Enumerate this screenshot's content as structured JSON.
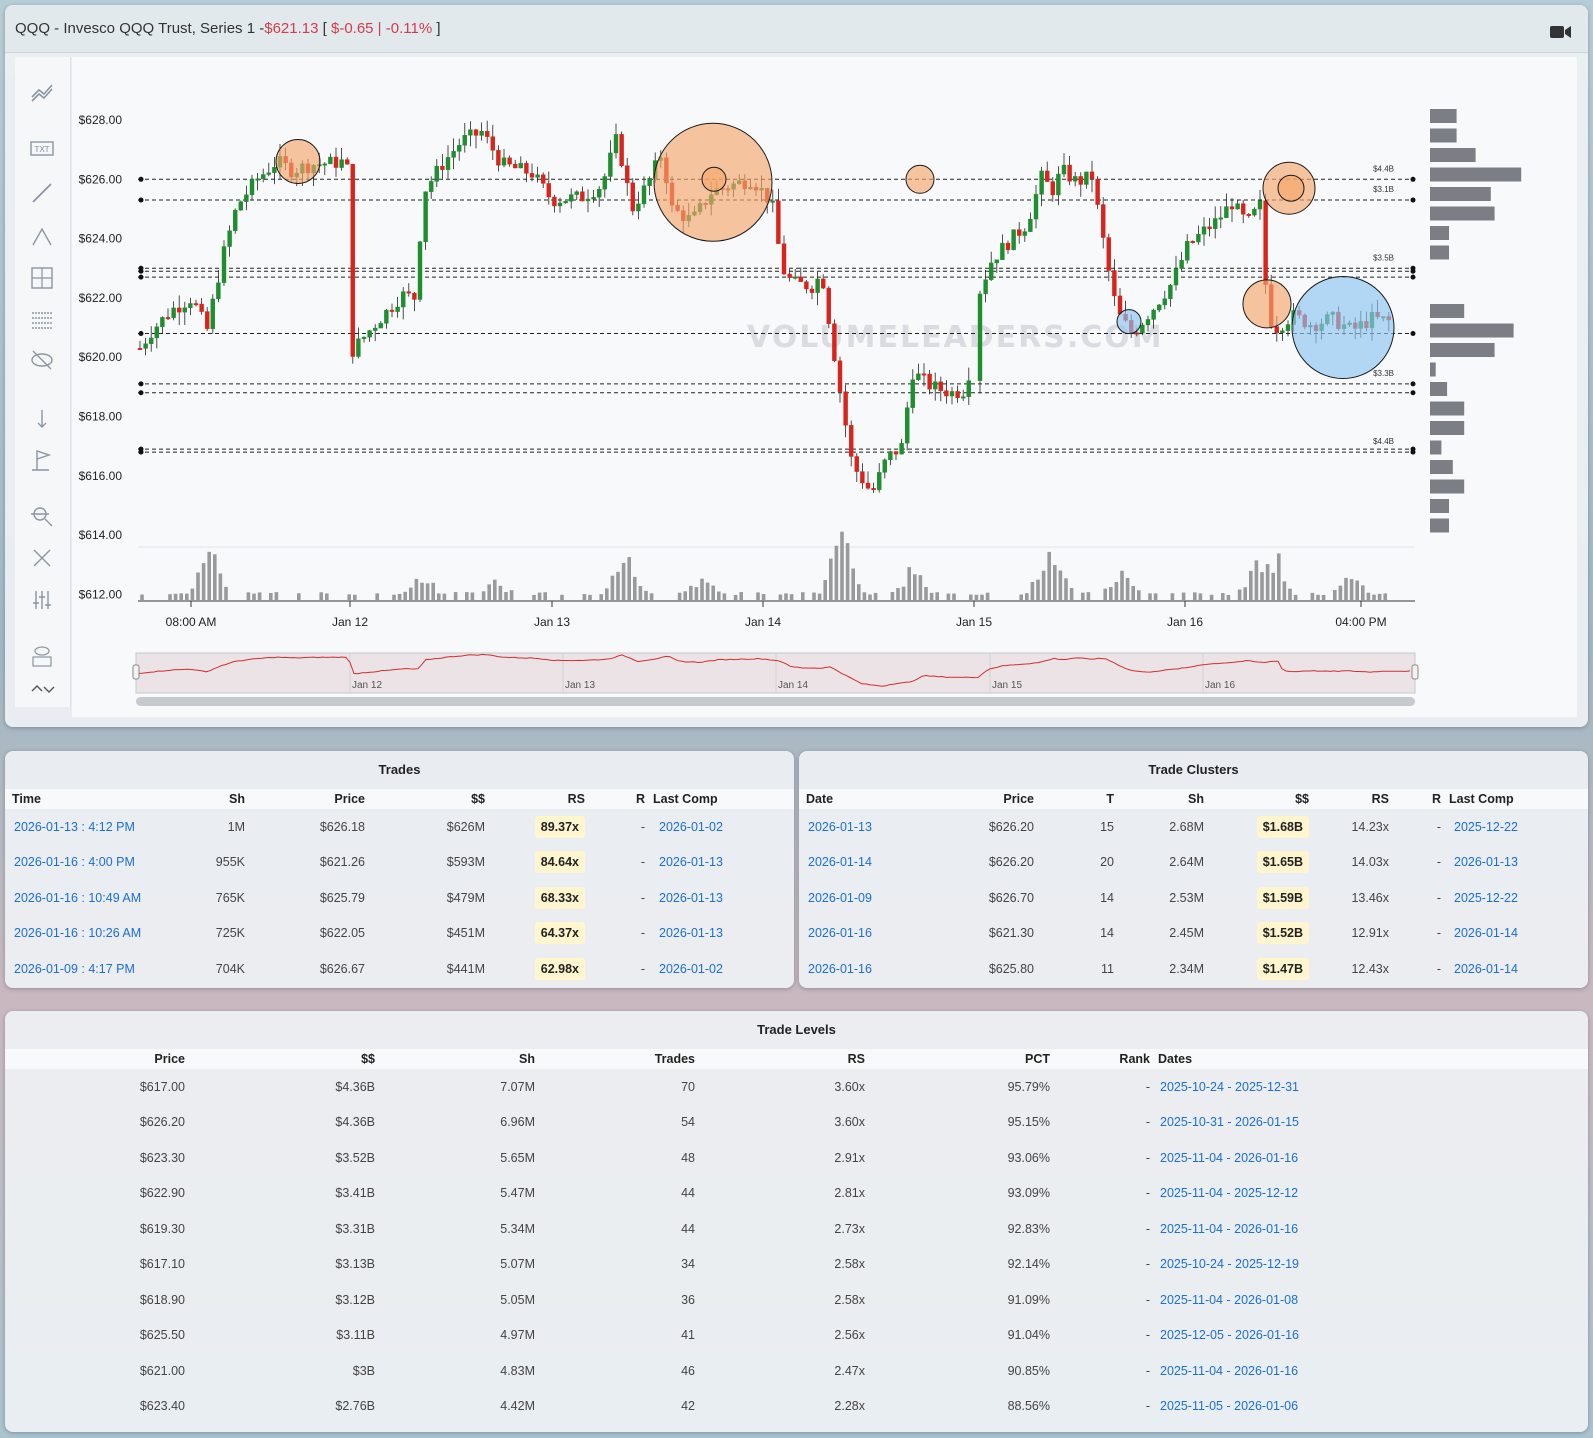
{
  "header": {
    "title": "QQQ - Invesco QQQ Trust, Series 1 - ",
    "price": "$621.13",
    "open_bracket": " [ ",
    "change": "$-0.65 | -0.11%",
    "close_bracket": " ]"
  },
  "chart": {
    "watermark": "VOLUMELEADERS.COM",
    "y_ticks": [
      "$628.00",
      "$626.00",
      "$624.00",
      "$622.00",
      "$620.00",
      "$618.00",
      "$616.00",
      "$614.00",
      "$612.00"
    ],
    "x_ticks": [
      "08:00 AM",
      "Jan 12",
      "Jan 13",
      "Jan 14",
      "Jan 15",
      "Jan 16",
      "04:00 PM"
    ],
    "navigator_ticks": [
      "Jan 12",
      "Jan 13",
      "Jan 14",
      "Jan 15",
      "Jan 16"
    ],
    "level_labels": [
      "$4.4B",
      "$3.1B",
      "$3.5B",
      "$3.3B",
      "$4.4B"
    ],
    "tools": [
      "trend-icon",
      "text-icon",
      "line-icon",
      "fib-icon",
      "crosshair-icon",
      "grid-icon",
      "hide-icon",
      "measure-icon",
      "flag-icon",
      "zoom-icon",
      "fullscreen-icon",
      "adjust-icon",
      "eye-value-icon",
      "folder-icon"
    ],
    "colors": {
      "up": "#1e8e2e",
      "down": "#d9241c",
      "orange_bubble": "#f5a66a",
      "blue_bubble": "#8cc4f0",
      "volume": "#9a9a9a",
      "profile": "#7b7f85"
    }
  },
  "trades": {
    "title": "Trades",
    "headers": [
      "Time",
      "Sh",
      "Price",
      "$$",
      "RS",
      "R",
      "Last Comp"
    ],
    "rows": [
      [
        "2026-01-13 : 4:12 PM",
        "1M",
        "$626.18",
        "$626M",
        "89.37x",
        "-",
        "2026-01-02"
      ],
      [
        "2026-01-16 : 4:00 PM",
        "955K",
        "$621.26",
        "$593M",
        "84.64x",
        "-",
        "2026-01-13"
      ],
      [
        "2026-01-16 : 10:49 AM",
        "765K",
        "$625.79",
        "$479M",
        "68.33x",
        "-",
        "2026-01-13"
      ],
      [
        "2026-01-16 : 10:26 AM",
        "725K",
        "$622.05",
        "$451M",
        "64.37x",
        "-",
        "2026-01-13"
      ],
      [
        "2026-01-09 : 4:17 PM",
        "704K",
        "$626.67",
        "$441M",
        "62.98x",
        "-",
        "2026-01-02"
      ]
    ]
  },
  "clusters": {
    "title": "Trade Clusters",
    "headers": [
      "Date",
      "Price",
      "T",
      "Sh",
      "$$",
      "RS",
      "R",
      "Last Comp"
    ],
    "rows": [
      [
        "2026-01-13",
        "$626.20",
        "15",
        "2.68M",
        "$1.68B",
        "14.23x",
        "-",
        "2025-12-22"
      ],
      [
        "2026-01-14",
        "$626.20",
        "20",
        "2.64M",
        "$1.65B",
        "14.03x",
        "-",
        "2026-01-13"
      ],
      [
        "2026-01-09",
        "$626.70",
        "14",
        "2.53M",
        "$1.59B",
        "13.46x",
        "-",
        "2025-12-22"
      ],
      [
        "2026-01-16",
        "$621.30",
        "14",
        "2.45M",
        "$1.52B",
        "12.91x",
        "-",
        "2026-01-14"
      ],
      [
        "2026-01-16",
        "$625.80",
        "11",
        "2.34M",
        "$1.47B",
        "12.43x",
        "-",
        "2026-01-14"
      ]
    ]
  },
  "levels": {
    "title": "Trade Levels",
    "headers": [
      "Price",
      "$$",
      "Sh",
      "Trades",
      "RS",
      "PCT",
      "Rank",
      "Dates"
    ],
    "rows": [
      [
        "$617.00",
        "$4.36B",
        "7.07M",
        "70",
        "3.60x",
        "95.79%",
        "-",
        "2025-10-24 - 2025-12-31"
      ],
      [
        "$626.20",
        "$4.36B",
        "6.96M",
        "54",
        "3.60x",
        "95.15%",
        "-",
        "2025-10-31 - 2026-01-15"
      ],
      [
        "$623.30",
        "$3.52B",
        "5.65M",
        "48",
        "2.91x",
        "93.06%",
        "-",
        "2025-11-04 - 2026-01-16"
      ],
      [
        "$622.90",
        "$3.41B",
        "5.47M",
        "44",
        "2.81x",
        "93.09%",
        "-",
        "2025-11-04 - 2025-12-12"
      ],
      [
        "$619.30",
        "$3.31B",
        "5.34M",
        "44",
        "2.73x",
        "92.83%",
        "-",
        "2025-11-04 - 2026-01-16"
      ],
      [
        "$617.10",
        "$3.13B",
        "5.07M",
        "34",
        "2.58x",
        "92.14%",
        "-",
        "2025-10-24 - 2025-12-19"
      ],
      [
        "$618.90",
        "$3.12B",
        "5.05M",
        "36",
        "2.58x",
        "91.09%",
        "-",
        "2025-11-04 - 2026-01-08"
      ],
      [
        "$625.50",
        "$3.11B",
        "4.97M",
        "41",
        "2.56x",
        "91.04%",
        "-",
        "2025-12-05 - 2026-01-16"
      ],
      [
        "$621.00",
        "$3B",
        "4.83M",
        "46",
        "2.47x",
        "90.85%",
        "-",
        "2025-11-04 - 2026-01-16"
      ],
      [
        "$623.40",
        "$2.76B",
        "4.42M",
        "42",
        "2.28x",
        "88.56%",
        "-",
        "2025-11-05 - 2026-01-06"
      ]
    ]
  }
}
